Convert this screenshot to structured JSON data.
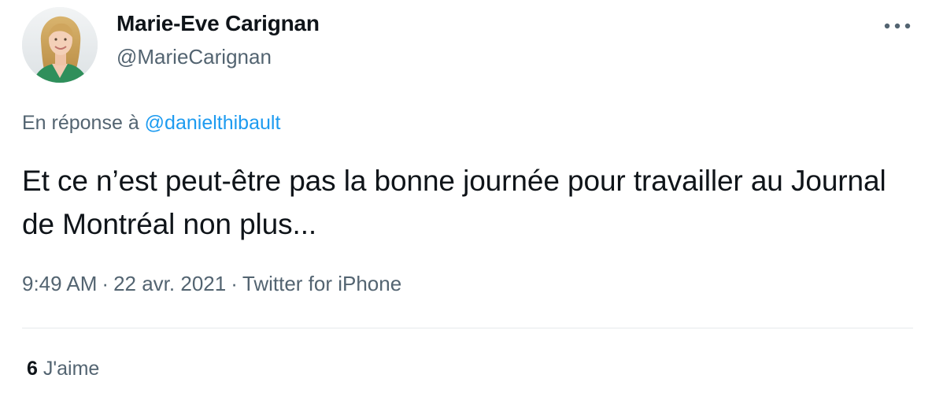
{
  "author": {
    "display_name": "Marie-Eve Carignan",
    "handle": "@MarieCarignan"
  },
  "reply": {
    "prefix": "En réponse à ",
    "mention": "@danielthibault"
  },
  "tweet": {
    "text": "Et ce n’est peut-être pas la bonne journée pour travailler au Journal de Montréal non plus..."
  },
  "meta": {
    "time": "9:49 AM",
    "separator": "·",
    "date": "22 avr. 2021",
    "source": "Twitter for iPhone"
  },
  "stats": {
    "likes_count": "6",
    "likes_label": "J'aime"
  },
  "icons": {
    "more": "more-horizontal-icon",
    "avatar": "profile-photo"
  },
  "colors": {
    "text_primary": "#0f1419",
    "text_secondary": "#536471",
    "link": "#1d9bf0",
    "divider": "#e5e9ec"
  }
}
